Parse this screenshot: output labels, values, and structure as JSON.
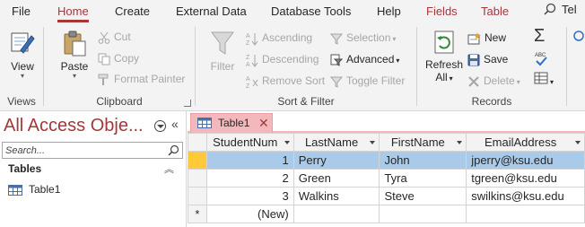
{
  "menu": {
    "tabs": [
      {
        "label": "File"
      },
      {
        "label": "Home"
      },
      {
        "label": "Create"
      },
      {
        "label": "External Data"
      },
      {
        "label": "Database Tools"
      },
      {
        "label": "Help"
      },
      {
        "label": "Fields"
      },
      {
        "label": "Table"
      }
    ],
    "active_tab": "Home",
    "tellme_label": "Tel"
  },
  "ribbon": {
    "views": {
      "view_label": "View",
      "group_label": "Views"
    },
    "clipboard": {
      "paste_label": "Paste",
      "cut_label": "Cut",
      "copy_label": "Copy",
      "format_painter_label": "Format Painter",
      "group_label": "Clipboard"
    },
    "sort_filter": {
      "filter_label": "Filter",
      "ascending_label": "Ascending",
      "descending_label": "Descending",
      "remove_sort_label": "Remove Sort",
      "selection_label": "Selection",
      "advanced_label": "Advanced",
      "toggle_filter_label": "Toggle Filter",
      "group_label": "Sort & Filter"
    },
    "records": {
      "refresh_label": "Refresh",
      "refresh_all_label": "All",
      "new_label": "New",
      "save_label": "Save",
      "delete_label": "Delete",
      "group_label": "Records"
    }
  },
  "nav": {
    "title": "All Access Obje...",
    "search_placeholder": "Search...",
    "section": "Tables",
    "items": [
      {
        "label": "Table1"
      }
    ]
  },
  "document": {
    "tab_label": "Table1",
    "close_glyph": "✕",
    "columns": [
      "StudentNum",
      "LastName",
      "FirstName",
      "EmailAddress"
    ],
    "rows": [
      {
        "id": "1",
        "last": "Perry",
        "first": "John",
        "email": "jperry@ksu.edu"
      },
      {
        "id": "2",
        "last": "Green",
        "first": "Tyra",
        "email": "tgreen@ksu.edu"
      },
      {
        "id": "3",
        "last": "Walkins",
        "first": "Steve",
        "email": "swilkins@ksu.edu"
      }
    ],
    "new_row_marker": "*",
    "new_row_label": "(New)"
  },
  "colors": {
    "accent": "#a4373a",
    "selected_row": "#a9cbe9",
    "record_selector": "#ffc93a",
    "doc_tab": "#f3b8bb"
  }
}
